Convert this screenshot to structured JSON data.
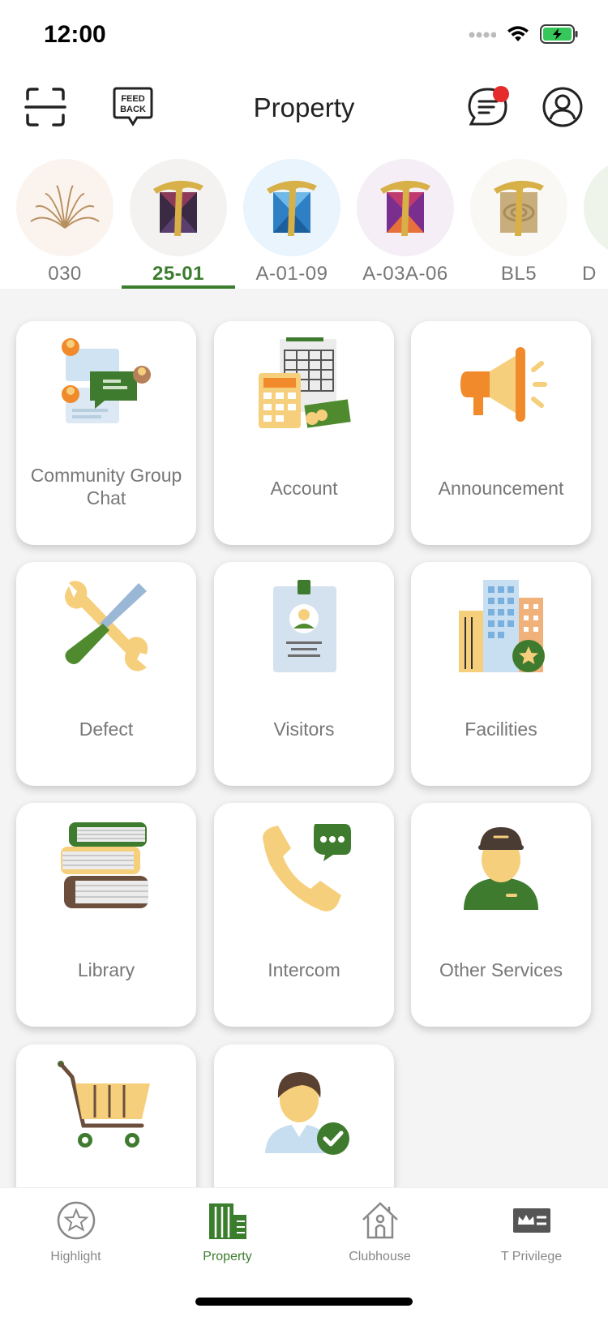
{
  "status_bar": {
    "time": "12:00"
  },
  "header": {
    "title": "Property",
    "feedback_icon_text_1": "FEED",
    "feedback_icon_text_2": "BACK"
  },
  "properties": [
    {
      "label": "030",
      "active": false
    },
    {
      "label": "25-01",
      "active": true
    },
    {
      "label": "A-01-09",
      "active": false
    },
    {
      "label": "A-03A-06",
      "active": false
    },
    {
      "label": "BL5",
      "active": false
    },
    {
      "label": "D",
      "active": false
    }
  ],
  "services": [
    {
      "label": "Community Group Chat",
      "icon": "group-chat-icon"
    },
    {
      "label": "Account",
      "icon": "calculator-icon"
    },
    {
      "label": "Announcement",
      "icon": "megaphone-icon"
    },
    {
      "label": "Defect",
      "icon": "tools-icon"
    },
    {
      "label": "Visitors",
      "icon": "visitor-badge-icon"
    },
    {
      "label": "Facilities",
      "icon": "building-icon"
    },
    {
      "label": "Library",
      "icon": "books-icon"
    },
    {
      "label": "Intercom",
      "icon": "phone-chat-icon"
    },
    {
      "label": "Other Services",
      "icon": "technician-icon"
    },
    {
      "label": "",
      "icon": "shopping-cart-icon"
    },
    {
      "label": "",
      "icon": "verified-user-icon"
    }
  ],
  "tabs": [
    {
      "label": "Highlight",
      "icon": "star-icon",
      "active": false
    },
    {
      "label": "Property",
      "icon": "property-icon",
      "active": true
    },
    {
      "label": "Clubhouse",
      "icon": "clubhouse-icon",
      "active": false
    },
    {
      "label": "T Privilege",
      "icon": "privilege-card-icon",
      "active": false
    }
  ],
  "colors": {
    "accent": "#3a7d2c",
    "notification": "#e52b2b",
    "icon_yellow": "#f6cf7c",
    "icon_orange": "#f08a2a"
  }
}
